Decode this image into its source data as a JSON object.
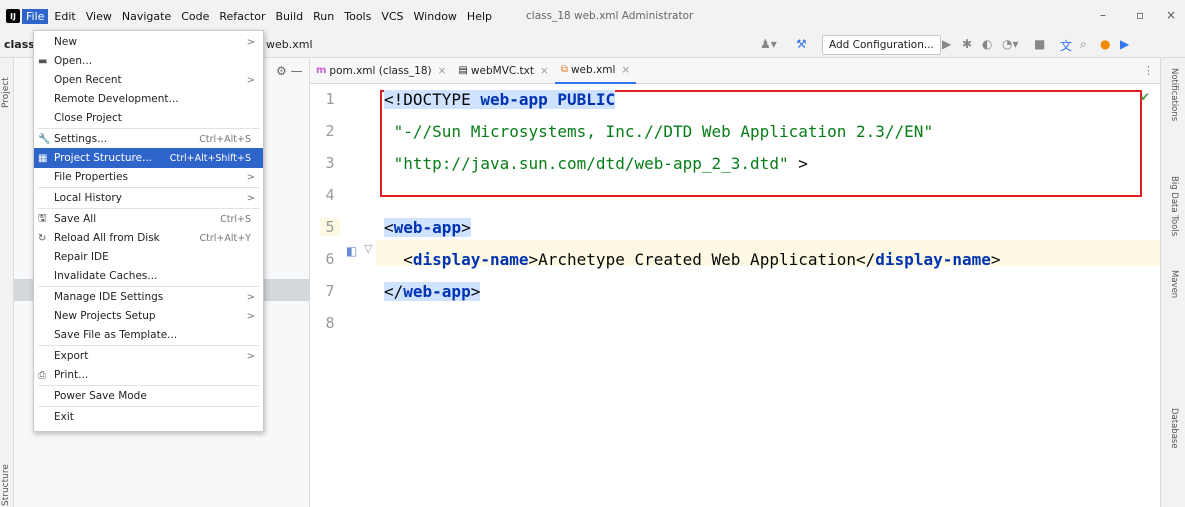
{
  "window": {
    "title": "class_18  web.xml  Administrator",
    "minimize": "–",
    "restore": "▫",
    "close": "×"
  },
  "menubar": [
    "File",
    "Edit",
    "View",
    "Navigate",
    "Code",
    "Refactor",
    "Build",
    "Run",
    "Tools",
    "VCS",
    "Window",
    "Help"
  ],
  "toolbar": {
    "project": "class",
    "file": "web.xml",
    "add_configuration": "Add Configuration..."
  },
  "left_stripe": {
    "project_tab": "Project",
    "structure_tab": "Structure"
  },
  "right_stripe": [
    "Notifications",
    "Database",
    "Maven",
    "Big Data Tools"
  ],
  "tabs": [
    {
      "label": "pom.xml (class_18)",
      "icon": "m-icon"
    },
    {
      "label": "webMVC.txt",
      "icon": "text-file-icon"
    },
    {
      "label": "web.xml",
      "icon": "xml-file-icon"
    }
  ],
  "editor": {
    "line_numbers": [
      "1",
      "2",
      "3",
      "4",
      "5",
      "6",
      "7",
      "8"
    ],
    "lines": {
      "l1a": "<!DOCTYPE ",
      "l1b": "web-app PUBLIC",
      "l2": " \"-//Sun Microsystems, Inc.//DTD Web Application 2.3//EN\"",
      "l3a": " \"http://java.sun.com/dtd/web-app_2_3.dtd\"",
      "l3b": " >",
      "l5a": "<",
      "l5b": "web-app",
      "l5c": ">",
      "l6a": "  <",
      "l6b": "display-name",
      "l6c": ">Archetype Created Web Application</",
      "l6d": "display-name",
      "l6e": ">",
      "l7a": "</",
      "l7b": "web-app",
      "l7c": ">"
    }
  },
  "file_menu": {
    "items": [
      {
        "label": "New",
        "arrow": ">"
      },
      {
        "label": "Open..."
      },
      {
        "label": "Open Recent",
        "arrow": ">"
      },
      {
        "label": "Remote Development..."
      },
      {
        "label": "Close Project"
      },
      {
        "label": "Settings...",
        "shortcut": "Ctrl+Alt+S"
      },
      {
        "label": "Project Structure...",
        "shortcut": "Ctrl+Alt+Shift+S"
      },
      {
        "label": "File Properties",
        "arrow": ">"
      },
      {
        "label": "Local History",
        "arrow": ">"
      },
      {
        "label": "Save All",
        "shortcut": "Ctrl+S"
      },
      {
        "label": "Reload All from Disk",
        "shortcut": "Ctrl+Alt+Y"
      },
      {
        "label": "Repair IDE"
      },
      {
        "label": "Invalidate Caches..."
      },
      {
        "label": "Manage IDE Settings",
        "arrow": ">"
      },
      {
        "label": "New Projects Setup",
        "arrow": ">"
      },
      {
        "label": "Save File as Template..."
      },
      {
        "label": "Export",
        "arrow": ">"
      },
      {
        "label": "Print..."
      },
      {
        "label": "Power Save Mode"
      },
      {
        "label": "Exit"
      }
    ]
  },
  "colors": {
    "accent": "#2f65ca",
    "highlight_box": "#e02020",
    "keyword": "#0033b3",
    "string": "#067d17"
  }
}
